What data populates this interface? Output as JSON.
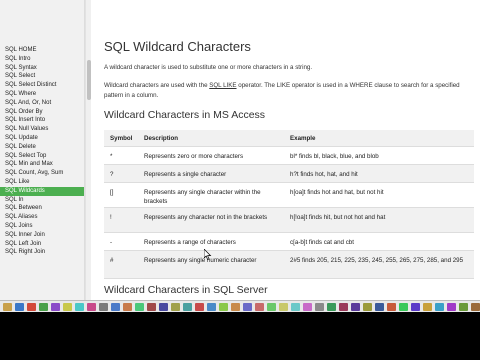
{
  "page": {
    "title": "SQL Wildcard Characters",
    "intro": "A wildcard character is used to substitute one or more characters in a string.",
    "para2_pre": "Wildcard characters are used with the ",
    "para2_link": "SQL LIKE",
    "para2_post": " operator. The LIKE operator is used in a WHERE clause to search for a specified pattern in a column.",
    "section1_heading": "Wildcard Characters in MS Access",
    "section2_heading": "Wildcard Characters in SQL Server"
  },
  "sidebar": {
    "items": [
      "SQL HOME",
      "SQL Intro",
      "SQL Syntax",
      "SQL Select",
      "SQL Select Distinct",
      "SQL Where",
      "SQL And, Or, Not",
      "SQL Order By",
      "SQL Insert Into",
      "SQL Null Values",
      "SQL Update",
      "SQL Delete",
      "SQL Select Top",
      "SQL Min and Max",
      "SQL Count, Avg, Sum",
      "SQL Like",
      "SQL Wildcards",
      "SQL In",
      "SQL Between",
      "SQL Aliases",
      "SQL Joins",
      "SQL Inner Join",
      "SQL Left Join",
      "SQL Right Join"
    ],
    "active_index": 16
  },
  "table": {
    "headers": [
      "Symbol",
      "Description",
      "Example"
    ],
    "rows": [
      {
        "symbol": "*",
        "description": "Represents zero or more characters",
        "example": "bl* finds bl, black, blue, and blob"
      },
      {
        "symbol": "?",
        "description": "Represents a single character",
        "example": "h?t finds hot, hat, and hit"
      },
      {
        "symbol": "[]",
        "description": "Represents any single character within the brackets",
        "example": "h[oa]t finds hot and hat, but not hit"
      },
      {
        "symbol": "!",
        "description": "Represents any character not in the brackets",
        "example": "h[!oa]t finds hit, but not hot and hat"
      },
      {
        "symbol": "-",
        "description": "Represents a range of characters",
        "example": "c[a-b]t finds cat and cbt"
      },
      {
        "symbol": "#",
        "description": "Represents any single numeric character",
        "example": "2#5 finds 205, 215, 225, 235, 245, 255, 265, 275, 285, and 295"
      }
    ]
  },
  "colors": {
    "accent": "#4CAF50",
    "row_shade": "#f1f1f1",
    "sidebar_bg": "#f1f1f1"
  }
}
